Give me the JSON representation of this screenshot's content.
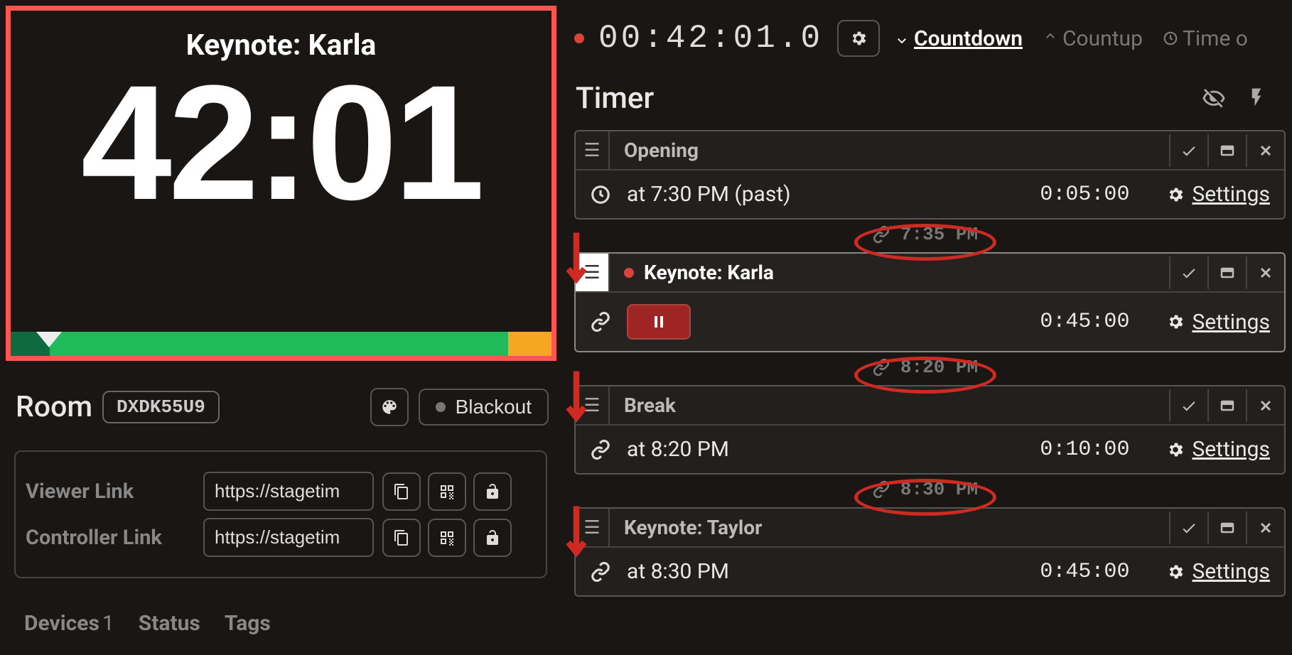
{
  "preview": {
    "title": "Keynote: Karla",
    "time": "42:01"
  },
  "room": {
    "label": "Room",
    "code": "DXDK55U9",
    "blackout_label": "Blackout"
  },
  "links": {
    "viewer_label": "Viewer Link",
    "viewer_value": "https://stagetim",
    "controller_label": "Controller Link",
    "controller_value": "https://stagetim"
  },
  "devices": {
    "label": "Devices",
    "count": "1",
    "status_label": "Status",
    "tags_label": "Tags"
  },
  "header": {
    "clock": "00:42:01.0",
    "countdown": "Countdown",
    "countup": "Countup",
    "timeof": "Time o"
  },
  "section": {
    "title": "Timer"
  },
  "timers": [
    {
      "title": "Opening",
      "schedule": "at 7:30 PM (past)",
      "duration": "0:05:00",
      "settings": "Settings",
      "link_time": "7:35 PM",
      "icon": "clock"
    },
    {
      "title": "Keynote: Karla",
      "duration": "0:45:00",
      "settings": "Settings",
      "link_time": "8:20 PM",
      "active": true,
      "icon": "link"
    },
    {
      "title": "Break",
      "schedule": "at 8:20 PM",
      "duration": "0:10:00",
      "settings": "Settings",
      "link_time": "8:30 PM",
      "icon": "link"
    },
    {
      "title": "Keynote: Taylor",
      "schedule": "at 8:30 PM",
      "duration": "0:45:00",
      "settings": "Settings",
      "icon": "link"
    }
  ]
}
